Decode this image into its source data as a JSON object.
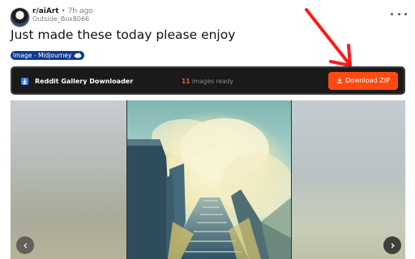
{
  "post": {
    "subreddit": "r/aiArt",
    "separator": "•",
    "time": "7h ago",
    "username": "Outside_Box8066",
    "title": "Just made these today please enjoy",
    "flair": "Image - Midjourney"
  },
  "toolbar": {
    "name": "Reddit Gallery Downloader",
    "image_count": "11",
    "count_suffix": "images ready",
    "download_label": "Download ZIP"
  },
  "colors": {
    "accent": "#ff4b12",
    "count": "#ff5a36",
    "flair_bg": "#0f3a8c",
    "annotation_arrow": "#ff1a1a"
  },
  "icons": {
    "more": "more-horizontal-icon",
    "download": "download-icon",
    "prev": "chevron-left-icon",
    "next": "chevron-right-icon"
  }
}
